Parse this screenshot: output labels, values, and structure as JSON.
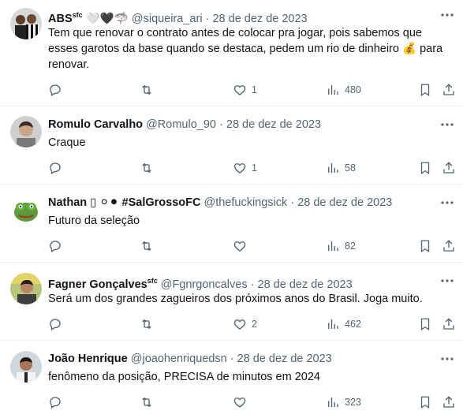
{
  "tweets": [
    {
      "name": "ABS",
      "badge": "sfc",
      "extra": "🤍🖤🦈",
      "handle": "@siqueira_ari",
      "dot": "·",
      "date": "28 de dez de 2023",
      "text_line1": "Tem que renovar o contrato antes de colocar pra jogar, pois sabemos que",
      "text_line2": "esses garotos da base quando se destaca,  pedem um rio de dinheiro 💰 para",
      "text_line3": "renovar.",
      "replies": "",
      "retweets": "",
      "likes": "1",
      "views": "480"
    },
    {
      "name": "Romulo Carvalho",
      "handle": "@Romulo_90",
      "dot": "·",
      "date": "28 de dez de 2023",
      "text_line1": "Craque",
      "likes": "1",
      "views": "58"
    },
    {
      "name": "Nathan",
      "extra": "▯ ⚪⚫ #SalGrossoFC",
      "handle": "@thefuckingsick",
      "dot": "·",
      "date": "28 de dez de 2023",
      "text_line1": "Futuro da seleção",
      "likes": "",
      "views": "82"
    },
    {
      "name": "Fagner Gonçalves",
      "badge": "sfc",
      "handle": "@Fgnrgoncalves",
      "dot": "·",
      "date": "28 de dez de 2023",
      "text_line1": "Será um dos grandes zagueiros dos próximos anos do Brasil. Joga muito.",
      "likes": "2",
      "views": "462"
    },
    {
      "name": "João Henrique",
      "handle": "@joaohenriquedsn",
      "dot": "·",
      "date": "28 de dez de 2023",
      "text_line1": "fenômeno da posição, PRECISA de minutos em 2024",
      "likes": "",
      "views": "323"
    }
  ],
  "icons": {
    "more": "more-horizontal-icon",
    "reply": "reply-icon",
    "retweet": "retweet-icon",
    "like": "heart-icon",
    "views": "views-chart-icon",
    "bookmark": "bookmark-icon",
    "share": "share-icon"
  },
  "colors": {
    "text": "#0f1419",
    "muted": "#536471",
    "divider": "#eff3f4"
  }
}
